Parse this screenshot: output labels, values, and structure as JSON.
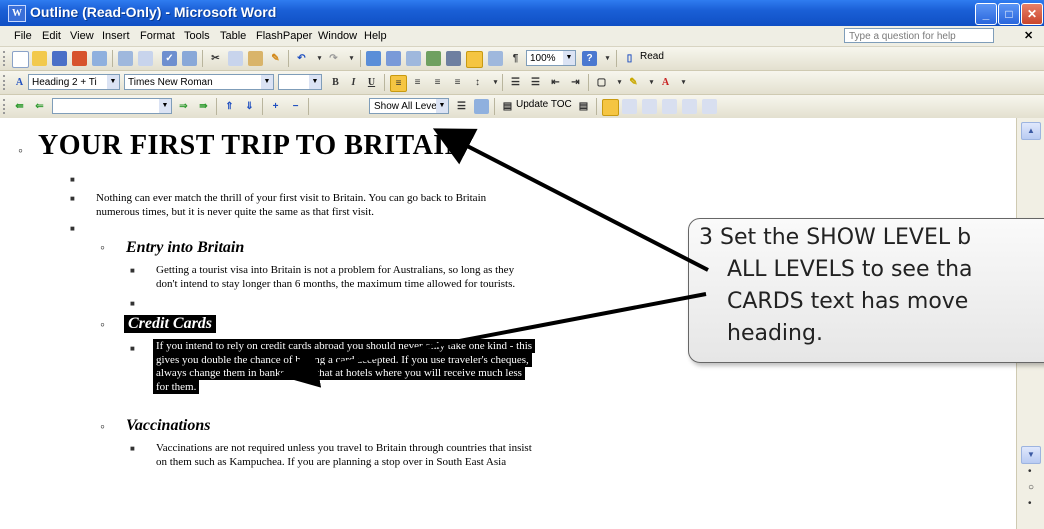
{
  "window": {
    "title": "Outline (Read-Only) - Microsoft Word",
    "title_icon": "word-doc-icon"
  },
  "menu": {
    "items": [
      "File",
      "Edit",
      "View",
      "Insert",
      "Format",
      "Tools",
      "Table",
      "FlashPaper",
      "Window",
      "Help"
    ],
    "help_placeholder": "Type a question for help"
  },
  "toolbar_standard": {
    "zoom": "100%",
    "read": "Read"
  },
  "toolbar_formatting": {
    "style": "Heading 2 + Ti",
    "font": "Times New Roman"
  },
  "toolbar_outlining": {
    "show_level": "Show All Levels",
    "update_toc": "Update TOC"
  },
  "document": {
    "heading1": "YOUR FIRST TRIP TO BRITAIN",
    "intro_line1": "Nothing can ever match the thrill of your first visit to Britain.  You can go back to Britain",
    "intro_line2": "numerous times, but it is never quite the same as that first visit.",
    "entry_heading": "Entry into Britain",
    "entry_line1": "Getting a tourist visa into Britain is not a problem for Australians, so long as they",
    "entry_line2": "don't intend to stay longer than 6 months, the maximum time allowed for tourists.",
    "credit_heading": "Credit Cards",
    "credit_line1": "If you intend to rely on credit cards abroad you should never only take one kind - this",
    "credit_line2": "gives you double the chance of having a card accepted.  If you use traveler's cheques,",
    "credit_line3": "always change them in banks rather that at hotels where you will receive much less",
    "credit_line4": "for them.",
    "vacc_heading": "Vaccinations",
    "vacc_line1": "Vaccinations are not required unless you travel to Britain through countries that insist",
    "vacc_line2": "on them such as Kampuchea. If you are planning a stop over in South East Asia"
  },
  "callout": {
    "line1": "3  Set the SHOW LEVEL b",
    "line2": "ALL LEVELS to see tha",
    "line3": "CARDS text has move",
    "line4": "heading."
  }
}
